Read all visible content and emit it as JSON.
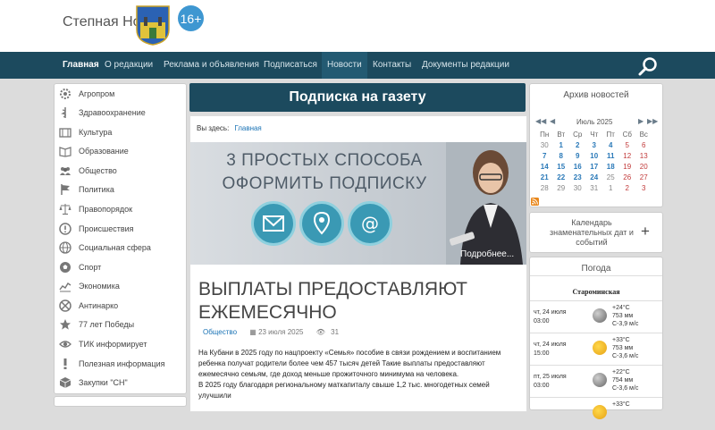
{
  "header": {
    "site_name": "Степная Новь",
    "age_badge": "16+"
  },
  "nav": {
    "items": [
      "Главная",
      "О редакции",
      "Реклама и объявления",
      "Подписаться",
      "Новости",
      "Контакты",
      "Документы редакции"
    ]
  },
  "sidebar": {
    "items": [
      {
        "label": "Агропром",
        "icon": "gear-icon"
      },
      {
        "label": "Здравоохранение",
        "icon": "medical-icon"
      },
      {
        "label": "Культура",
        "icon": "theater-icon"
      },
      {
        "label": "Образование",
        "icon": "book-icon"
      },
      {
        "label": "Общество",
        "icon": "people-icon"
      },
      {
        "label": "Политика",
        "icon": "flag-icon"
      },
      {
        "label": "Правопорядок",
        "icon": "scales-icon"
      },
      {
        "label": "Происшествия",
        "icon": "warning-icon"
      },
      {
        "label": "Социальная сфера",
        "icon": "globe-icon"
      },
      {
        "label": "Спорт",
        "icon": "ball-icon"
      },
      {
        "label": "Экономика",
        "icon": "chart-icon"
      },
      {
        "label": "Антинарко",
        "icon": "forbidden-icon"
      },
      {
        "label": "77 лет Победы",
        "icon": "star-icon"
      },
      {
        "label": "ТИК информирует",
        "icon": "eye-icon"
      },
      {
        "label": "Полезная информация",
        "icon": "exclamation-icon"
      },
      {
        "label": "Закупки \"СН\"",
        "icon": "box-icon"
      }
    ]
  },
  "main": {
    "title": "Подписка на газету",
    "breadcrumb_label": "Вы здесь:",
    "breadcrumb_link": "Главная",
    "banner_line1": "3 ПРОСТЫХ СПОСОБА",
    "banner_line2": "ОФОРМИТЬ ПОДПИСКУ",
    "banner_more": "Подробнее...",
    "article_title": "ВЫПЛАТЫ ПРЕДОСТАВЛЯЮТ ЕЖЕМЕСЯЧНО",
    "category": "Общество",
    "date": "23 июля 2025",
    "views": "31",
    "body_p1": "На Кубани в 2025 году по нацпроекту «Семья» пособие в связи рождением и воспитанием ребенка получат родители более чем 457 тысяч детей Такие выплаты предоставляют ежемесячно семьям, где доход меньше прожиточного минимума на человека.",
    "body_p2": "В 2025 году благодаря региональному маткапиталу свыше 1,2 тыс. многодетных семей улучшили"
  },
  "archive": {
    "title": "Архив новостей",
    "month": "Июль 2025",
    "weekdays": [
      "Пн",
      "Вт",
      "Ср",
      "Чт",
      "Пт",
      "Сб",
      "Вс"
    ],
    "weeks": [
      [
        "30",
        "1",
        "2",
        "3",
        "4",
        "5",
        "6"
      ],
      [
        "7",
        "8",
        "9",
        "10",
        "11",
        "12",
        "13"
      ],
      [
        "14",
        "15",
        "16",
        "17",
        "18",
        "19",
        "20"
      ],
      [
        "21",
        "22",
        "23",
        "24",
        "25",
        "26",
        "27"
      ],
      [
        "28",
        "29",
        "30",
        "31",
        "1",
        "2",
        "3"
      ]
    ]
  },
  "calendar_box": {
    "title": "Календарь знаменательных дат и событий",
    "toggle": "+"
  },
  "weather": {
    "title": "Погода",
    "city": "Староминская",
    "rows": [
      {
        "day": "чт, 24 июля",
        "time": "03:00",
        "temp": "+24°C",
        "pressure": "753 мм",
        "wind": "С-3,9 м/с",
        "icon": "moon-cloud-icon"
      },
      {
        "day": "чт, 24 июля",
        "time": "15:00",
        "temp": "+33°C",
        "pressure": "753 мм",
        "wind": "С-3,6 м/с",
        "icon": "sun-cloud-icon"
      },
      {
        "day": "пт, 25 июля",
        "time": "03:00",
        "temp": "+22°C",
        "pressure": "754 мм",
        "wind": "С-3,6 м/с",
        "icon": "moon-cloud-icon"
      },
      {
        "day": "",
        "time": "",
        "temp": "+33°C",
        "pressure": "",
        "wind": "",
        "icon": "sun-cloud-icon"
      }
    ]
  }
}
